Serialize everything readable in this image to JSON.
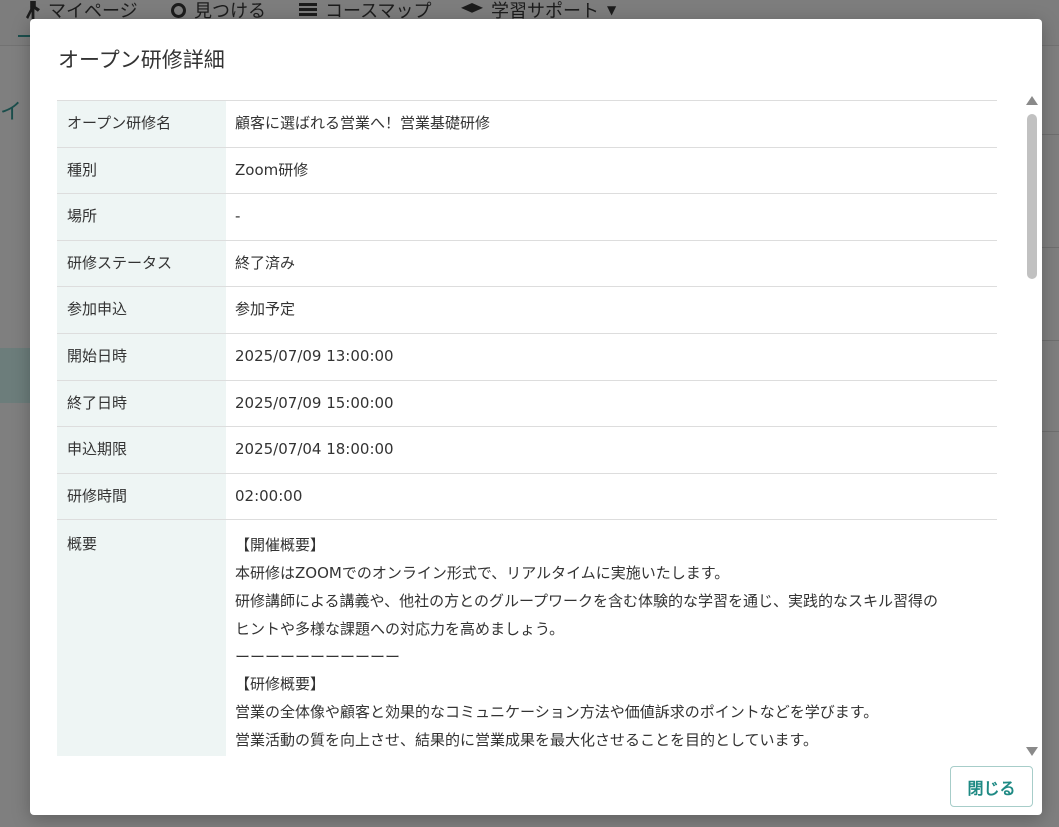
{
  "background": {
    "nav": [
      {
        "label": "マイページ",
        "icon": "person-icon"
      },
      {
        "label": "見つける",
        "icon": "search-icon"
      },
      {
        "label": "コースマップ",
        "icon": "list-icon"
      },
      {
        "label": "学習サポート",
        "icon": "graduation-cap-icon"
      }
    ],
    "left_text": "イ"
  },
  "modal": {
    "title": "オープン研修詳細",
    "rows": [
      {
        "label": "オープン研修名",
        "value": "顧客に選ばれる営業へ！営業基礎研修"
      },
      {
        "label": "種別",
        "value": "Zoom研修"
      },
      {
        "label": "場所",
        "value": "-"
      },
      {
        "label": "研修ステータス",
        "value": "終了済み"
      },
      {
        "label": "参加申込",
        "value": "参加予定"
      },
      {
        "label": "開始日時",
        "value": "2025/07/09 13:00:00"
      },
      {
        "label": "終了日時",
        "value": "2025/07/09 15:00:00"
      },
      {
        "label": "申込期限",
        "value": "2025/07/04 18:00:00"
      },
      {
        "label": "研修時間",
        "value": "02:00:00"
      }
    ],
    "summary": {
      "label": "概要",
      "lines": [
        "【開催概要】",
        "本研修はZOOMでのオンライン形式で、リアルタイムに実施いたします。",
        "研修講師による講義や、他社の方とのグループワークを含む体験的な学習を通じ、実践的なスキル習得の",
        "ヒントや多様な課題への対応力を高めましょう。",
        "ーーーーーーーーーーー",
        "【研修概要】",
        "営業の全体像や顧客と効果的なコミュニケーション方法や価値訴求のポイントなどを学びます。",
        "営業活動の質を向上させ、結果的に営業成果を最大化させることを目的としています。"
      ]
    },
    "close_label": "閉じる"
  }
}
